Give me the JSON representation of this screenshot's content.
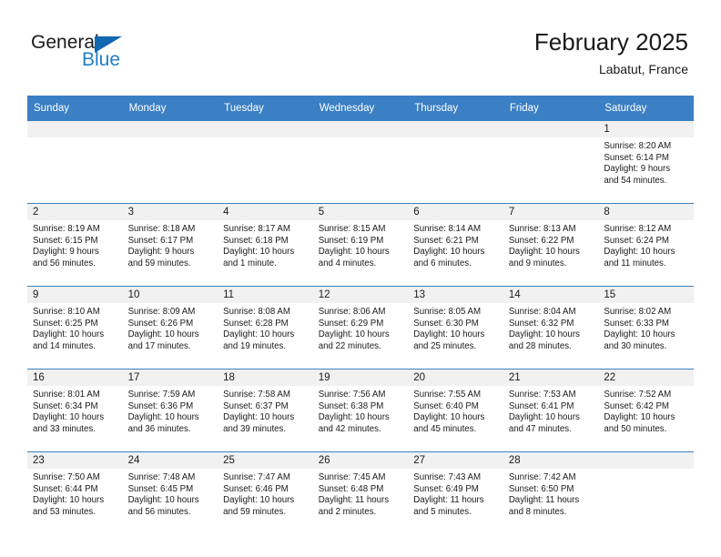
{
  "brand": {
    "word_one": "General",
    "word_two": "Blue",
    "logo_icon": "triangle-flag-icon",
    "color_primary": "#1167b1",
    "color_secondary": "#1f7fc4"
  },
  "header": {
    "title": "February 2025",
    "subtitle": "Labatut, France"
  },
  "calendar": {
    "header_bg": "#3b7fc4",
    "daynum_bg": "#f1f1f1",
    "weekday_headers": [
      "Sunday",
      "Monday",
      "Tuesday",
      "Wednesday",
      "Thursday",
      "Friday",
      "Saturday"
    ],
    "weeks": [
      [
        {
          "day": "",
          "sunrise": "",
          "sunset": "",
          "daylight_line1": "",
          "daylight_line2": ""
        },
        {
          "day": "",
          "sunrise": "",
          "sunset": "",
          "daylight_line1": "",
          "daylight_line2": ""
        },
        {
          "day": "",
          "sunrise": "",
          "sunset": "",
          "daylight_line1": "",
          "daylight_line2": ""
        },
        {
          "day": "",
          "sunrise": "",
          "sunset": "",
          "daylight_line1": "",
          "daylight_line2": ""
        },
        {
          "day": "",
          "sunrise": "",
          "sunset": "",
          "daylight_line1": "",
          "daylight_line2": ""
        },
        {
          "day": "",
          "sunrise": "",
          "sunset": "",
          "daylight_line1": "",
          "daylight_line2": ""
        },
        {
          "day": "1",
          "sunrise": "Sunrise: 8:20 AM",
          "sunset": "Sunset: 6:14 PM",
          "daylight_line1": "Daylight: 9 hours",
          "daylight_line2": "and 54 minutes."
        }
      ],
      [
        {
          "day": "2",
          "sunrise": "Sunrise: 8:19 AM",
          "sunset": "Sunset: 6:15 PM",
          "daylight_line1": "Daylight: 9 hours",
          "daylight_line2": "and 56 minutes."
        },
        {
          "day": "3",
          "sunrise": "Sunrise: 8:18 AM",
          "sunset": "Sunset: 6:17 PM",
          "daylight_line1": "Daylight: 9 hours",
          "daylight_line2": "and 59 minutes."
        },
        {
          "day": "4",
          "sunrise": "Sunrise: 8:17 AM",
          "sunset": "Sunset: 6:18 PM",
          "daylight_line1": "Daylight: 10 hours",
          "daylight_line2": "and 1 minute."
        },
        {
          "day": "5",
          "sunrise": "Sunrise: 8:15 AM",
          "sunset": "Sunset: 6:19 PM",
          "daylight_line1": "Daylight: 10 hours",
          "daylight_line2": "and 4 minutes."
        },
        {
          "day": "6",
          "sunrise": "Sunrise: 8:14 AM",
          "sunset": "Sunset: 6:21 PM",
          "daylight_line1": "Daylight: 10 hours",
          "daylight_line2": "and 6 minutes."
        },
        {
          "day": "7",
          "sunrise": "Sunrise: 8:13 AM",
          "sunset": "Sunset: 6:22 PM",
          "daylight_line1": "Daylight: 10 hours",
          "daylight_line2": "and 9 minutes."
        },
        {
          "day": "8",
          "sunrise": "Sunrise: 8:12 AM",
          "sunset": "Sunset: 6:24 PM",
          "daylight_line1": "Daylight: 10 hours",
          "daylight_line2": "and 11 minutes."
        }
      ],
      [
        {
          "day": "9",
          "sunrise": "Sunrise: 8:10 AM",
          "sunset": "Sunset: 6:25 PM",
          "daylight_line1": "Daylight: 10 hours",
          "daylight_line2": "and 14 minutes."
        },
        {
          "day": "10",
          "sunrise": "Sunrise: 8:09 AM",
          "sunset": "Sunset: 6:26 PM",
          "daylight_line1": "Daylight: 10 hours",
          "daylight_line2": "and 17 minutes."
        },
        {
          "day": "11",
          "sunrise": "Sunrise: 8:08 AM",
          "sunset": "Sunset: 6:28 PM",
          "daylight_line1": "Daylight: 10 hours",
          "daylight_line2": "and 19 minutes."
        },
        {
          "day": "12",
          "sunrise": "Sunrise: 8:06 AM",
          "sunset": "Sunset: 6:29 PM",
          "daylight_line1": "Daylight: 10 hours",
          "daylight_line2": "and 22 minutes."
        },
        {
          "day": "13",
          "sunrise": "Sunrise: 8:05 AM",
          "sunset": "Sunset: 6:30 PM",
          "daylight_line1": "Daylight: 10 hours",
          "daylight_line2": "and 25 minutes."
        },
        {
          "day": "14",
          "sunrise": "Sunrise: 8:04 AM",
          "sunset": "Sunset: 6:32 PM",
          "daylight_line1": "Daylight: 10 hours",
          "daylight_line2": "and 28 minutes."
        },
        {
          "day": "15",
          "sunrise": "Sunrise: 8:02 AM",
          "sunset": "Sunset: 6:33 PM",
          "daylight_line1": "Daylight: 10 hours",
          "daylight_line2": "and 30 minutes."
        }
      ],
      [
        {
          "day": "16",
          "sunrise": "Sunrise: 8:01 AM",
          "sunset": "Sunset: 6:34 PM",
          "daylight_line1": "Daylight: 10 hours",
          "daylight_line2": "and 33 minutes."
        },
        {
          "day": "17",
          "sunrise": "Sunrise: 7:59 AM",
          "sunset": "Sunset: 6:36 PM",
          "daylight_line1": "Daylight: 10 hours",
          "daylight_line2": "and 36 minutes."
        },
        {
          "day": "18",
          "sunrise": "Sunrise: 7:58 AM",
          "sunset": "Sunset: 6:37 PM",
          "daylight_line1": "Daylight: 10 hours",
          "daylight_line2": "and 39 minutes."
        },
        {
          "day": "19",
          "sunrise": "Sunrise: 7:56 AM",
          "sunset": "Sunset: 6:38 PM",
          "daylight_line1": "Daylight: 10 hours",
          "daylight_line2": "and 42 minutes."
        },
        {
          "day": "20",
          "sunrise": "Sunrise: 7:55 AM",
          "sunset": "Sunset: 6:40 PM",
          "daylight_line1": "Daylight: 10 hours",
          "daylight_line2": "and 45 minutes."
        },
        {
          "day": "21",
          "sunrise": "Sunrise: 7:53 AM",
          "sunset": "Sunset: 6:41 PM",
          "daylight_line1": "Daylight: 10 hours",
          "daylight_line2": "and 47 minutes."
        },
        {
          "day": "22",
          "sunrise": "Sunrise: 7:52 AM",
          "sunset": "Sunset: 6:42 PM",
          "daylight_line1": "Daylight: 10 hours",
          "daylight_line2": "and 50 minutes."
        }
      ],
      [
        {
          "day": "23",
          "sunrise": "Sunrise: 7:50 AM",
          "sunset": "Sunset: 6:44 PM",
          "daylight_line1": "Daylight: 10 hours",
          "daylight_line2": "and 53 minutes."
        },
        {
          "day": "24",
          "sunrise": "Sunrise: 7:48 AM",
          "sunset": "Sunset: 6:45 PM",
          "daylight_line1": "Daylight: 10 hours",
          "daylight_line2": "and 56 minutes."
        },
        {
          "day": "25",
          "sunrise": "Sunrise: 7:47 AM",
          "sunset": "Sunset: 6:46 PM",
          "daylight_line1": "Daylight: 10 hours",
          "daylight_line2": "and 59 minutes."
        },
        {
          "day": "26",
          "sunrise": "Sunrise: 7:45 AM",
          "sunset": "Sunset: 6:48 PM",
          "daylight_line1": "Daylight: 11 hours",
          "daylight_line2": "and 2 minutes."
        },
        {
          "day": "27",
          "sunrise": "Sunrise: 7:43 AM",
          "sunset": "Sunset: 6:49 PM",
          "daylight_line1": "Daylight: 11 hours",
          "daylight_line2": "and 5 minutes."
        },
        {
          "day": "28",
          "sunrise": "Sunrise: 7:42 AM",
          "sunset": "Sunset: 6:50 PM",
          "daylight_line1": "Daylight: 11 hours",
          "daylight_line2": "and 8 minutes."
        },
        {
          "day": "",
          "sunrise": "",
          "sunset": "",
          "daylight_line1": "",
          "daylight_line2": ""
        }
      ]
    ]
  }
}
